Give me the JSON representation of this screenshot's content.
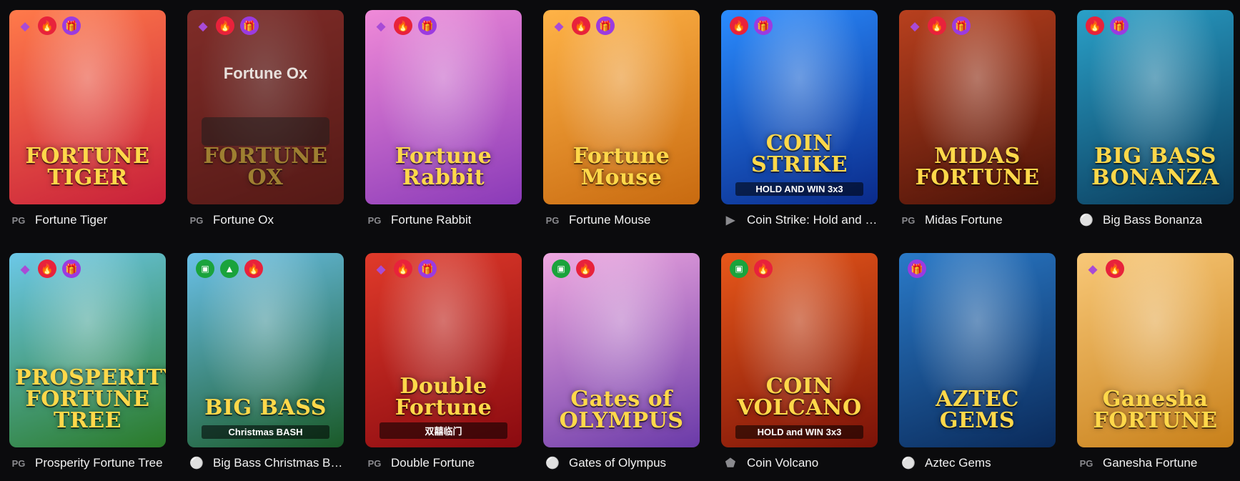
{
  "games": [
    {
      "title": "Fortune Tiger",
      "provider": "PG",
      "art": "FORTUNE TIGER",
      "badges": [
        "diamond",
        "fire",
        "gift"
      ],
      "colors": [
        "#ff7a4a",
        "#c8203a"
      ]
    },
    {
      "title": "Fortune Ox",
      "provider": "PG",
      "art": "FORTUNE OX",
      "overlay": "Fortune Ox",
      "dim": true,
      "badges": [
        "diamond",
        "fire",
        "gift"
      ],
      "colors": [
        "#c8413a",
        "#7a1e18"
      ]
    },
    {
      "title": "Fortune Rabbit",
      "provider": "PG",
      "art": "Fortune Rabbit",
      "badges": [
        "diamond",
        "fire",
        "gift"
      ],
      "colors": [
        "#f08ad8",
        "#8a3ab8"
      ]
    },
    {
      "title": "Fortune Mouse",
      "provider": "PG",
      "art": "Fortune Mouse",
      "badges": [
        "diamond",
        "fire",
        "gift"
      ],
      "colors": [
        "#ffb347",
        "#c86a10"
      ]
    },
    {
      "title": "Coin Strike: Hold and Win",
      "provider": "pragmatic",
      "art": "COIN STRIKE",
      "sub": "HOLD AND WIN 3x3",
      "badges": [
        "fire",
        "gift"
      ],
      "colors": [
        "#2a8cff",
        "#0a2a8a"
      ]
    },
    {
      "title": "Midas Fortune",
      "provider": "PG",
      "art": "MIDAS FORTUNE",
      "badges": [
        "diamond",
        "fire",
        "gift"
      ],
      "colors": [
        "#b8401e",
        "#4a1208"
      ]
    },
    {
      "title": "Big Bass Bonanza",
      "provider": "fishing",
      "art": "BIG BASS BONANZA",
      "badges": [
        "fire",
        "gift"
      ],
      "colors": [
        "#2aa0c8",
        "#0a3a5a"
      ]
    },
    {
      "title": "Prosperity Fortune Tree",
      "provider": "PG",
      "art": "PROSPERITY FORTUNE TREE",
      "badges": [
        "diamond",
        "fire",
        "gift"
      ],
      "colors": [
        "#6cc8e8",
        "#2a7a28"
      ]
    },
    {
      "title": "Big Bass Christmas Bash",
      "provider": "fishing",
      "art": "BIG BASS",
      "sub": "Christmas BASH",
      "badges": [
        "cash",
        "tree",
        "fire"
      ],
      "colors": [
        "#6ac0e8",
        "#1a5a28"
      ]
    },
    {
      "title": "Double Fortune",
      "provider": "PG",
      "art": "Double Fortune",
      "sub": "双囍临门",
      "badges": [
        "diamond",
        "fire",
        "gift"
      ],
      "colors": [
        "#e03a2a",
        "#8a0a10"
      ]
    },
    {
      "title": "Gates of Olympus",
      "provider": "fishing",
      "art": "Gates of OLYMPUS",
      "badges": [
        "cash",
        "fire"
      ],
      "colors": [
        "#f0a8e0",
        "#6a3aa8"
      ]
    },
    {
      "title": "Coin Volcano",
      "provider": "shield",
      "art": "COIN VOLCANO",
      "sub": "HOLD and WIN 3x3",
      "badges": [
        "cash",
        "fire"
      ],
      "colors": [
        "#e8581a",
        "#7a1208"
      ]
    },
    {
      "title": "Aztec Gems",
      "provider": "fishing",
      "art": "AZTEC GEMS",
      "badges": [
        "gift"
      ],
      "colors": [
        "#2a7ac8",
        "#0a2a5a"
      ]
    },
    {
      "title": "Ganesha Fortune",
      "provider": "PG",
      "art": "Ganesha FORTUNE",
      "badges": [
        "diamond",
        "fire"
      ],
      "colors": [
        "#f8c878",
        "#c8801a"
      ]
    }
  ],
  "icons": {
    "diamond": "◆",
    "fire": "🔥",
    "gift": "🎁",
    "tree": "▲",
    "cash": "▣",
    "pragmatic": "▶",
    "fishing": "⚪",
    "shield": "⬟"
  }
}
